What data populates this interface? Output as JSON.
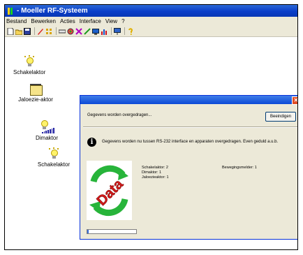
{
  "window": {
    "title": "- Moeller RF-Systeem"
  },
  "menu": [
    "Bestand",
    "Bewerken",
    "Acties",
    "Interface",
    "View",
    "?"
  ],
  "toolbar_icons": [
    "new-icon",
    "open-icon",
    "save-icon",
    "edit-icon",
    "grid-icon",
    "connect-icon",
    "radio-icon",
    "tools-icon",
    "wand-icon",
    "monitor-icon",
    "chart-icon",
    "interface-icon",
    "help-icon"
  ],
  "devices": [
    {
      "label": "Schakelaktor",
      "icon": "bulb-icon"
    },
    {
      "label": "Jaloezie-aktor",
      "icon": "blind-icon"
    },
    {
      "label": "Dimaktor",
      "icon": "dimmer-icon"
    },
    {
      "label": "Schakelaktor",
      "icon": "bulb-icon"
    }
  ],
  "dialog": {
    "status": "Gegevens worden overgedragen...",
    "button": "Beeindigen",
    "message": "Gegevens worden nu tussen RS-232 interface en apparaten overgedragen. Even geduld a.u.b.",
    "image_text": "Data",
    "counts": [
      "Schakelaktor: 2",
      "Dimaktor: 1",
      "Jaloezieaktor: 1"
    ],
    "motion": "Bewegingsmelder: 1",
    "progress": 0.03
  },
  "colors": {
    "title_blue": "#0a3ec9",
    "dialog_bg": "#ece9d8",
    "arrow_green": "#27b43a",
    "data_red": "#d61b1b"
  }
}
